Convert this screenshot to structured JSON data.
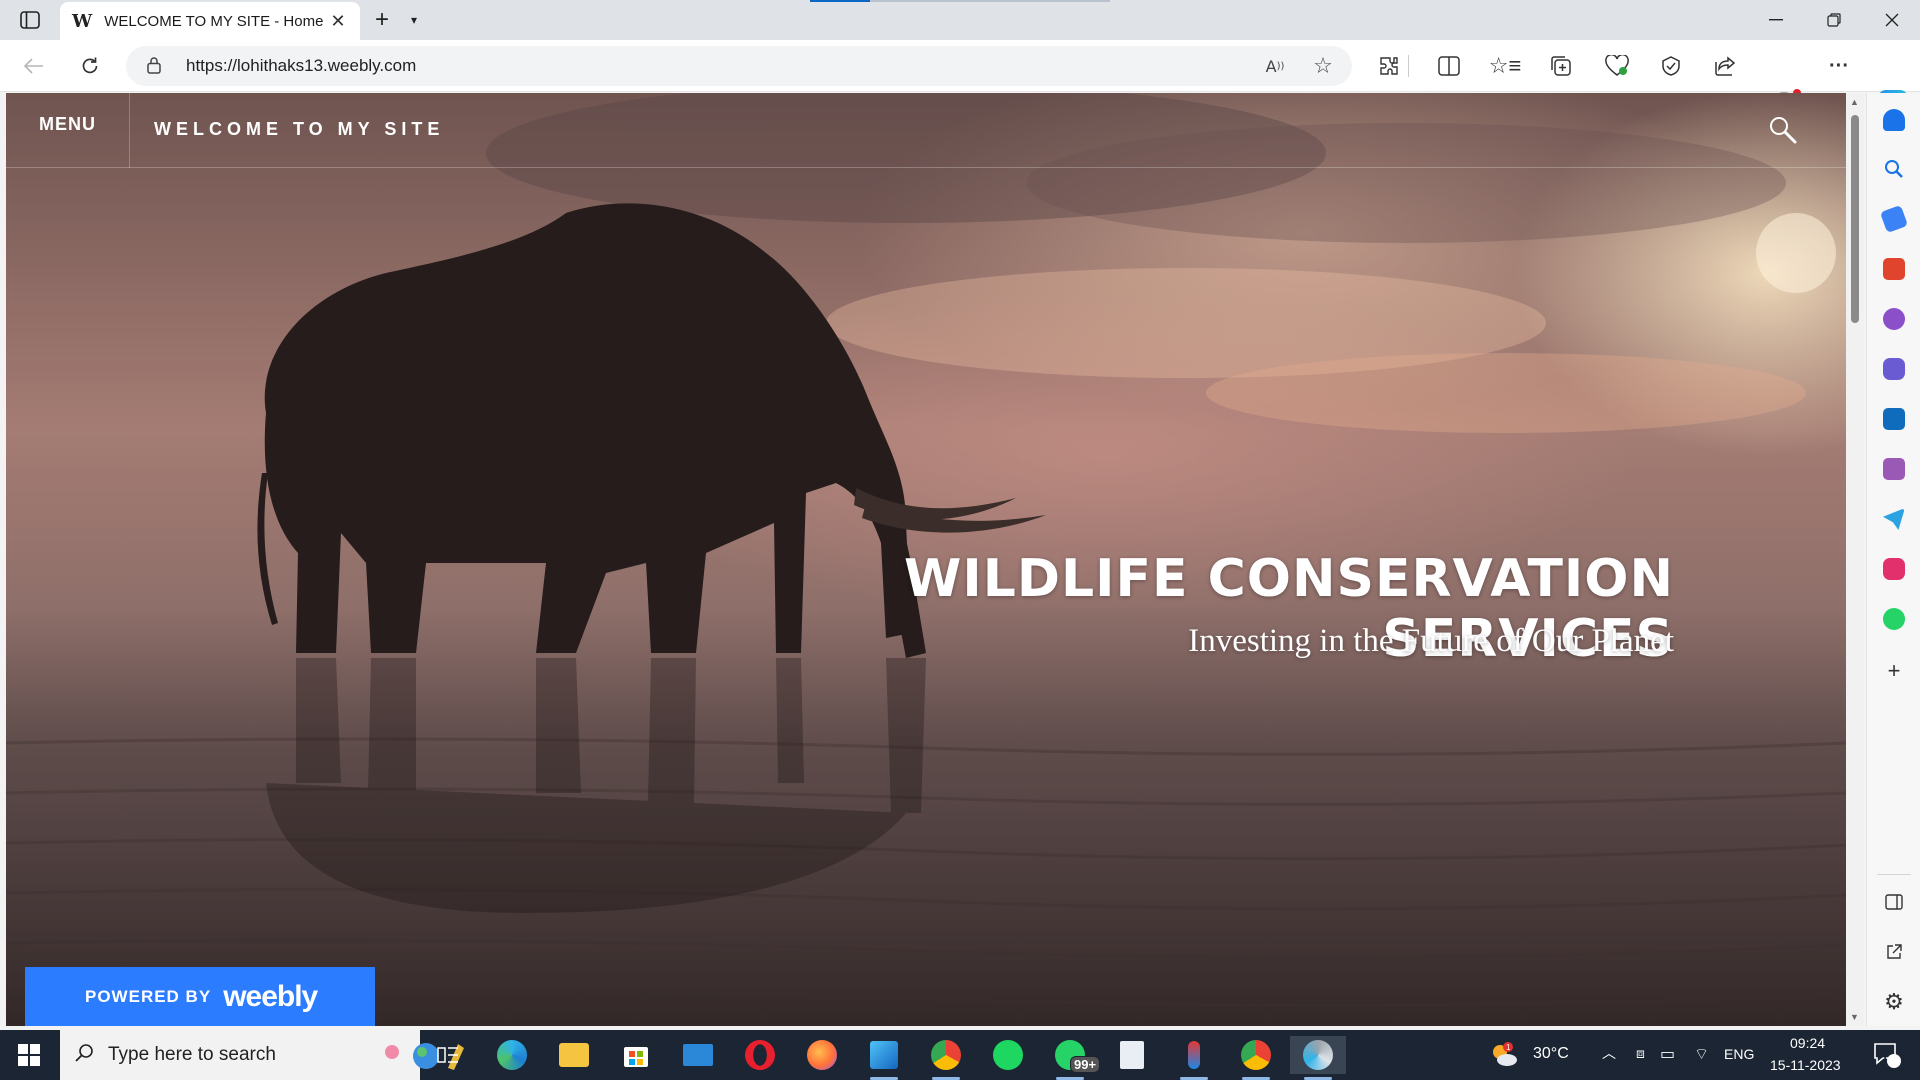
{
  "browser": {
    "tab": {
      "favicon": "W",
      "title": "WELCOME TO MY SITE - Home"
    },
    "address": {
      "url": "https://lohithaks13.weebly.com"
    }
  },
  "site": {
    "menu_label": "MENU",
    "title": "WELCOME TO MY SITE",
    "headline": "WILDLIFE CONSERVATION SERVICES",
    "subhead": "Investing in the Future of Our Planet",
    "powered_prefix": "POWERED BY",
    "powered_brand": "weebly"
  },
  "taskbar": {
    "search_placeholder": "Type here to search",
    "whatsapp_badge": "99+",
    "temperature": "30°C",
    "language": "ENG",
    "time": "09:24",
    "date": "15-11-2023",
    "notifications": "2"
  },
  "colors": {
    "weebly_blue": "#2b7cff",
    "taskbar": "#1b2533",
    "accent": "#0a66c2"
  },
  "icons": {
    "sidebar": [
      "bell-icon",
      "search-icon",
      "tag-icon",
      "toolbox-icon",
      "games-icon",
      "office-icon",
      "outlook-icon",
      "designer-icon",
      "telegram-icon",
      "instagram-icon",
      "whatsapp-icon",
      "add-icon",
      "split-screen-icon",
      "open-external-icon",
      "settings-icon"
    ],
    "taskbar_apps": [
      "task-view-icon",
      "edge-icon",
      "file-explorer-icon",
      "store-icon",
      "mail-icon",
      "opera-icon",
      "firefox-icon",
      "photos-icon",
      "chrome-icon",
      "spotify-icon",
      "whatsapp-icon",
      "notes-icon",
      "paint-icon",
      "chrome-profile-icon",
      "edge-active-icon"
    ]
  }
}
